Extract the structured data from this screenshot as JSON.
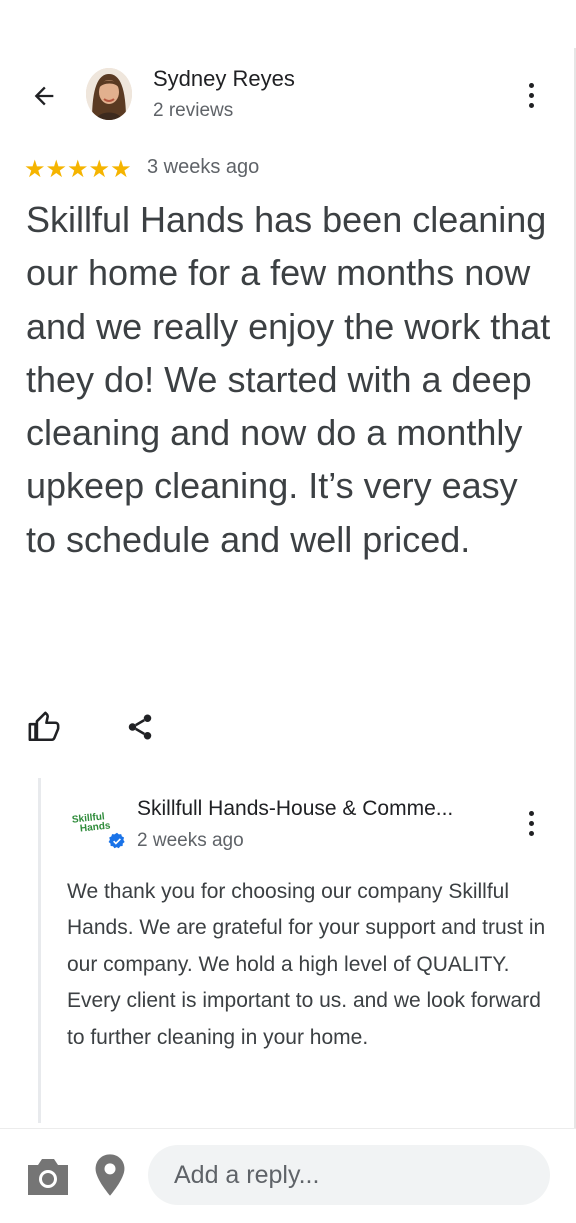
{
  "header": {
    "reviewer_name": "Sydney Reyes",
    "reviewer_meta": "2 reviews"
  },
  "review": {
    "rating": 5,
    "stars": "★★★★★",
    "time": "3 weeks ago",
    "text": "Skillful Hands has been cleaning our home for a few months now and we really enjoy the work that they do! We started with a deep cleaning and now do a monthly upkeep cleaning. It’s very easy to schedule and well priced."
  },
  "owner_reply": {
    "logo_text_line1": "Skillful",
    "logo_text_line2": "Hands",
    "name": "Skillfull Hands-House & Comme...",
    "time": "2 weeks ago",
    "text": "We thank you for choosing our company Skillful Hands.  We are grateful for your support and trust in our company.  We hold a high level of QUALITY.  Every client is important to us.  and we look forward to further cleaning in your home."
  },
  "reply_bar": {
    "placeholder": "Add a reply..."
  },
  "colors": {
    "star": "#f5b400",
    "verified": "#1a73e8",
    "logo_green": "#2e8b3a",
    "icon_gray": "#757575"
  },
  "icons": {
    "back": "arrow-left-icon",
    "more": "more-vert-icon",
    "like": "thumb-up-icon",
    "share": "share-icon",
    "camera": "camera-icon",
    "location": "location-pin-icon",
    "verified": "verified-badge-icon"
  }
}
